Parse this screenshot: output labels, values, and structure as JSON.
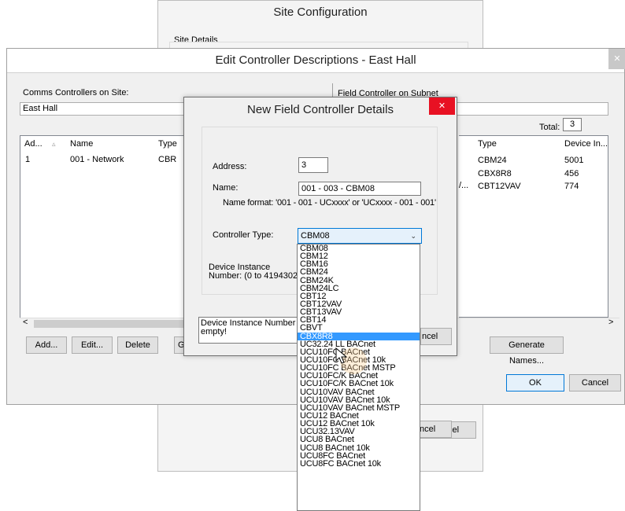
{
  "site_config": {
    "title": "Site Configuration",
    "group_label": "Site Details",
    "cancel_label": "Cancel"
  },
  "edit_dialog": {
    "title": "Edit Controller Descriptions - East Hall",
    "close_glyph": "✕",
    "left": {
      "label": "Comms Controllers on Site:",
      "site_value": "East Hall",
      "columns": [
        "Ad...",
        "Name",
        "Type"
      ],
      "rows": [
        {
          "address": "1",
          "name": "001 - Network",
          "type": "CBR"
        }
      ]
    },
    "right": {
      "label": "Field Controller on Subnet",
      "total_label": "Total:",
      "total_value": "3",
      "columns": [
        "Type",
        "Device In..."
      ],
      "truncated_cell": "/...",
      "rows": [
        {
          "type": "CBM24",
          "device": "5001"
        },
        {
          "type": "CBX8R8",
          "device": "456"
        },
        {
          "type": "CBT12VAV",
          "device": "774"
        }
      ]
    },
    "buttons": {
      "add": "Add...",
      "edit": "Edit...",
      "delete": "Delete",
      "generate_partial": "G",
      "generate_names": "Generate Names...",
      "ok": "OK",
      "cancel": "Cancel"
    },
    "scroll_left": "<",
    "scroll_right": ">"
  },
  "new_dialog": {
    "title": "New Field Controller Details",
    "close_glyph": "✕",
    "address_label": "Address:",
    "address_value": "3",
    "name_label": "Name:",
    "name_value": "001 - 003 - CBM08",
    "name_format": "Name format: '001 - 001 - UCxxxx' or 'UCxxxx - 001 - 001'",
    "type_label": "Controller Type:",
    "type_value": "CBM08",
    "instance_label_1": "Device Instance",
    "instance_label_2": "Number: (0 to 4194302)",
    "error_line1": "Device Instance Number mu",
    "error_line2": "empty!",
    "cancel_partial": "ncel"
  },
  "dropdown": {
    "options": [
      "CBM08",
      "CBM12",
      "CBM16",
      "CBM24",
      "CBM24K",
      "CBM24LC",
      "CBT12",
      "CBT12VAV",
      "CBT13VAV",
      "CBT14",
      "CBVT",
      "CBX8R8",
      "UC32.24 LL BACnet",
      "UCU10FC BACnet",
      "UCU10FC BACnet 10k",
      "UCU10FC BACnet MSTP",
      "UCU10FC/K BACnet",
      "UCU10FC/K BACnet 10k",
      "UCU10VAV BACnet",
      "UCU10VAV BACnet 10k",
      "UCU10VAV BACnet MSTP",
      "UCU12 BACnet",
      "UCU12 BACnet 10k",
      "UCU32.13VAV",
      "UCU8 BACnet",
      "UCU8 BACnet 10k",
      "UCU8FC BACnet",
      "UCU8FC BACnet 10k"
    ],
    "selected_index": 11
  },
  "colors": {
    "accent": "#3399ff",
    "close_red": "#e81123",
    "window_bg": "#f0f0f0"
  }
}
